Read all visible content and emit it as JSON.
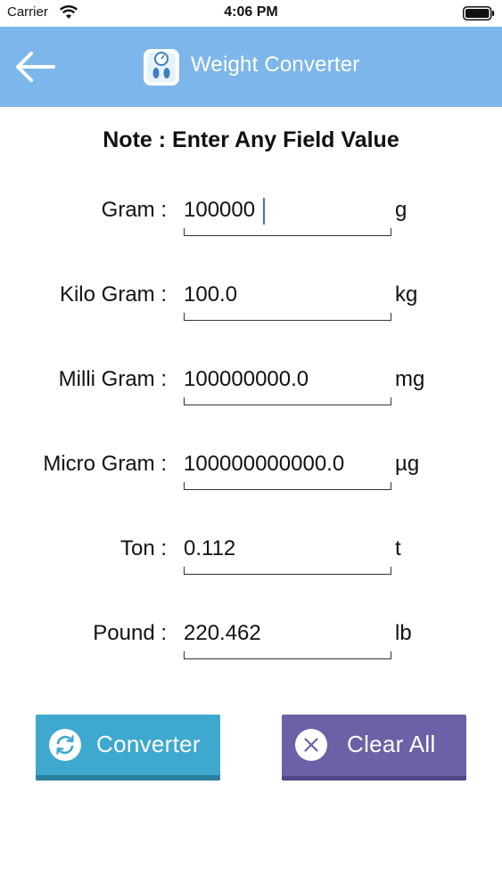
{
  "status_bar": {
    "carrier": "Carrier",
    "time": "4:06 PM"
  },
  "nav": {
    "title": "Weight Converter",
    "back_icon": "arrow-left-icon",
    "logo_icon": "weighing-scale-icon",
    "color": "#7db6ea"
  },
  "note": "Note : Enter Any Field Value",
  "fields": [
    {
      "label": "Gram :",
      "value": "100000",
      "unit": "g"
    },
    {
      "label": "Kilo Gram :",
      "value": "100.0",
      "unit": "kg"
    },
    {
      "label": "Milli Gram :",
      "value": "100000000.0",
      "unit": "mg"
    },
    {
      "label": "Micro Gram :",
      "value": "100000000000.0",
      "unit": "µg"
    },
    {
      "label": "Ton :",
      "value": "0.112",
      "unit": "t"
    },
    {
      "label": "Pound :",
      "value": "220.462",
      "unit": "lb"
    }
  ],
  "buttons": {
    "converter": {
      "label": "Converter",
      "icon": "refresh-icon",
      "color": "#3fa8cf"
    },
    "clear": {
      "label": "Clear All",
      "icon": "close-circle-icon",
      "color": "#6a61a6"
    }
  }
}
